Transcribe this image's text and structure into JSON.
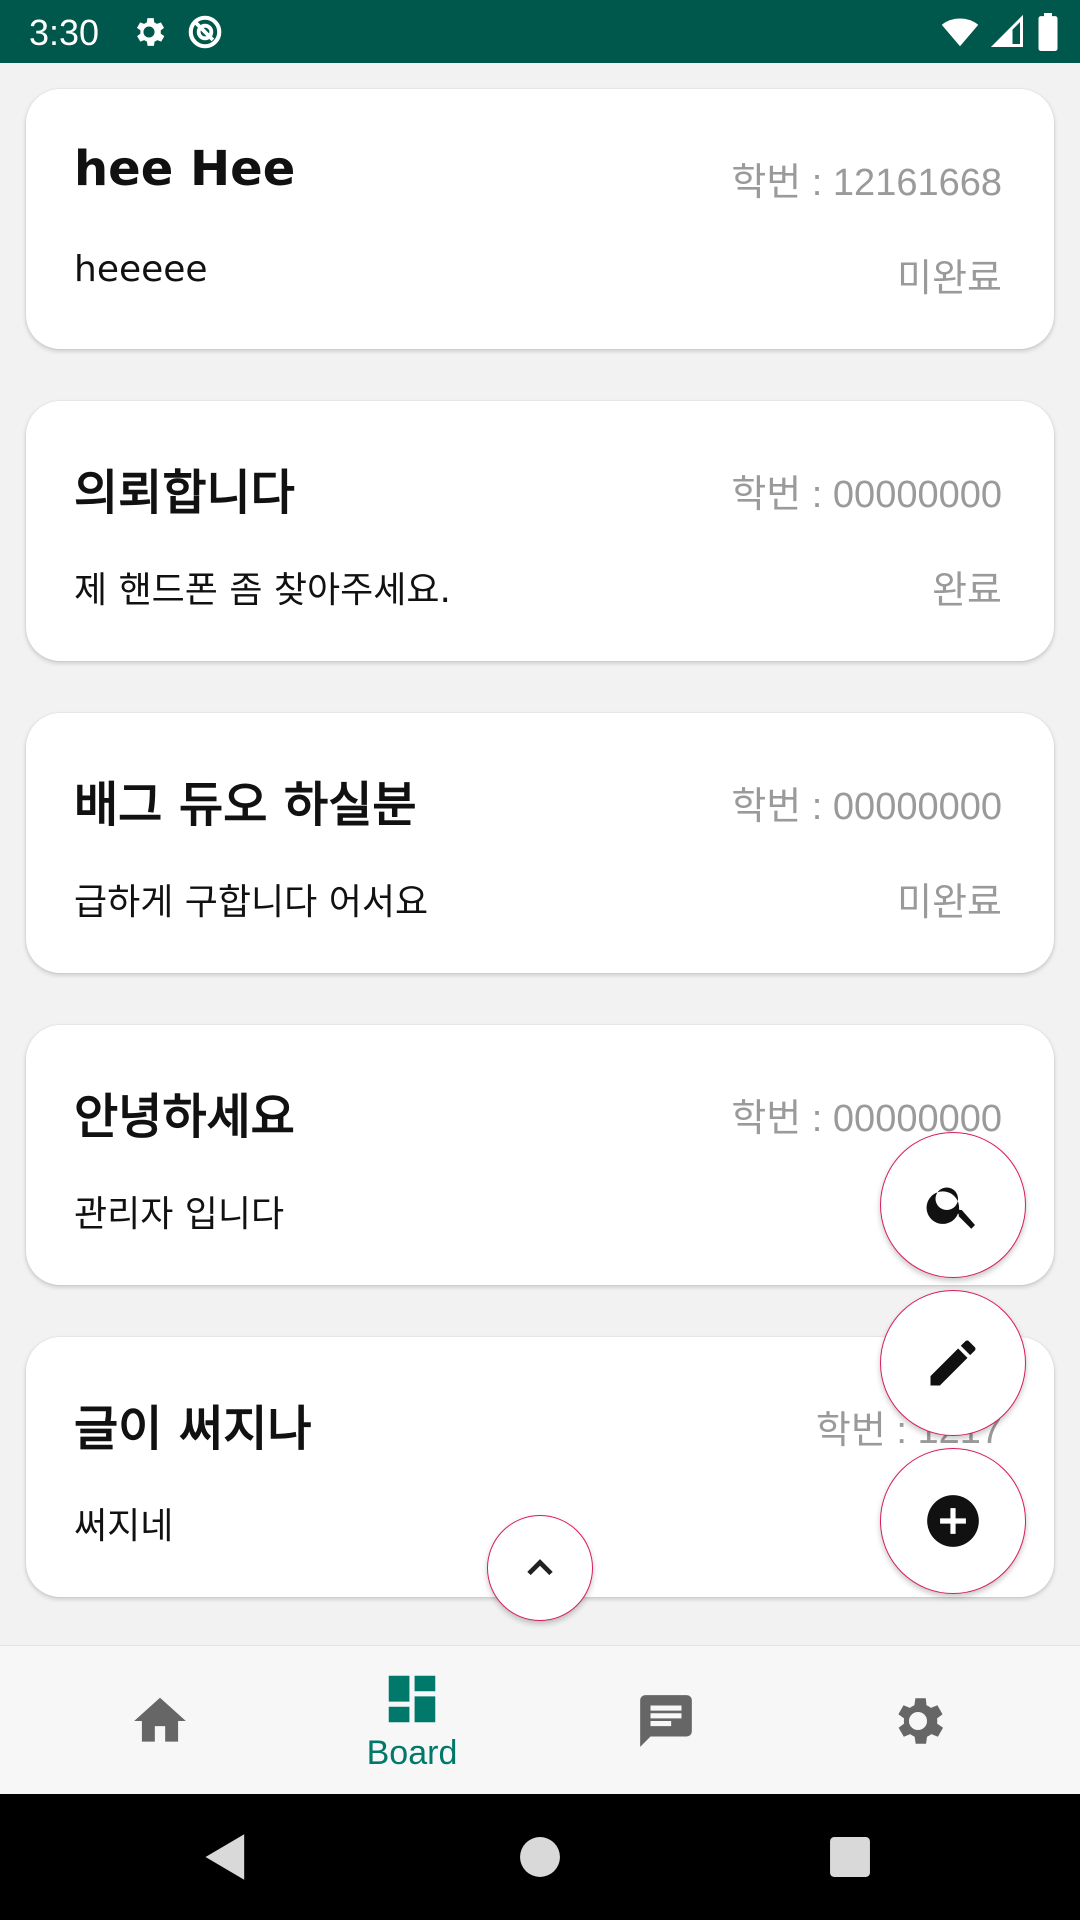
{
  "status_bar": {
    "time": "3:30"
  },
  "posts": [
    {
      "title": "hee Hee",
      "student_id": "학번 : 12161668",
      "body": "heeeee",
      "status": "미완료"
    },
    {
      "title": "의뢰합니다",
      "student_id": "학번 : 00000000",
      "body": "제 핸드폰 좀 찾아주세요.",
      "status": "완료"
    },
    {
      "title": "배그 듀오 하실분",
      "student_id": "학번 : 00000000",
      "body": "급하게 구합니다 어서요",
      "status": "미완료"
    },
    {
      "title": "안녕하세요",
      "student_id": "학번 : 00000000",
      "body": "관리자 입니다",
      "status": ""
    },
    {
      "title": "글이 써지나",
      "student_id": "학번 : 1217",
      "body": "써지네",
      "status": ""
    }
  ],
  "bottom_nav": {
    "board_label": "Board"
  },
  "colors": {
    "status_bar": "#00574b",
    "accent": "#00796b",
    "fab_border": "#d81b60"
  }
}
